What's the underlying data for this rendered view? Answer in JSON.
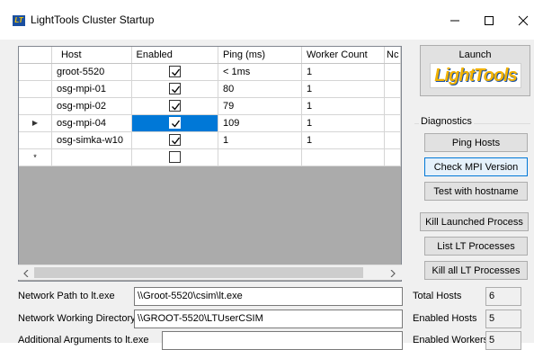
{
  "window": {
    "title": "LightTools Cluster Startup",
    "icon_text": "LT",
    "controls": {
      "minimize": "—",
      "maximize": "☐",
      "close": "✕"
    }
  },
  "grid": {
    "columns": [
      "Host",
      "Enabled",
      "Ping (ms)",
      "Worker Count",
      "Nc"
    ],
    "rows": [
      {
        "host": "groot-5520",
        "enabled": true,
        "ping": "< 1ms",
        "workers": "1"
      },
      {
        "host": "osg-mpi-01",
        "enabled": true,
        "ping": "80",
        "workers": "1"
      },
      {
        "host": "osg-mpi-02",
        "enabled": true,
        "ping": "79",
        "workers": "1"
      },
      {
        "host": "osg-mpi-04",
        "enabled": true,
        "ping": "109",
        "workers": "1"
      },
      {
        "host": "osg-simka-w10",
        "enabled": true,
        "ping": "1",
        "workers": "1"
      }
    ],
    "current_row_marker": "▶",
    "new_row_marker": "*",
    "scroll_left": "◀",
    "scroll_right": "▶"
  },
  "launch": {
    "label": "Launch",
    "logo_text": "LightTools"
  },
  "diagnostics": {
    "label": "Diagnostics",
    "ping_hosts": "Ping Hosts",
    "check_mpi": "Check MPI Version",
    "test_hostname": "Test with hostname"
  },
  "process_buttons": {
    "kill_launched": "Kill Launched Process",
    "list_lt": "List LT Processes",
    "kill_all": "Kill all LT Processes"
  },
  "fields": {
    "network_path_label": "Network Path to lt.exe",
    "network_path_value": "\\\\Groot-5520\\csim\\lt.exe",
    "working_dir_label": "Network Working Directory",
    "working_dir_value": "\\\\GROOT-5520\\LTUserCSIM",
    "args_label": "Additional Arguments to lt.exe",
    "args_value": ""
  },
  "stats": {
    "total_hosts_label": "Total Hosts",
    "total_hosts_value": "6",
    "enabled_hosts_label": "Enabled Hosts",
    "enabled_hosts_value": "5",
    "enabled_workers_label": "Enabled Workers",
    "enabled_workers_value": "5"
  }
}
